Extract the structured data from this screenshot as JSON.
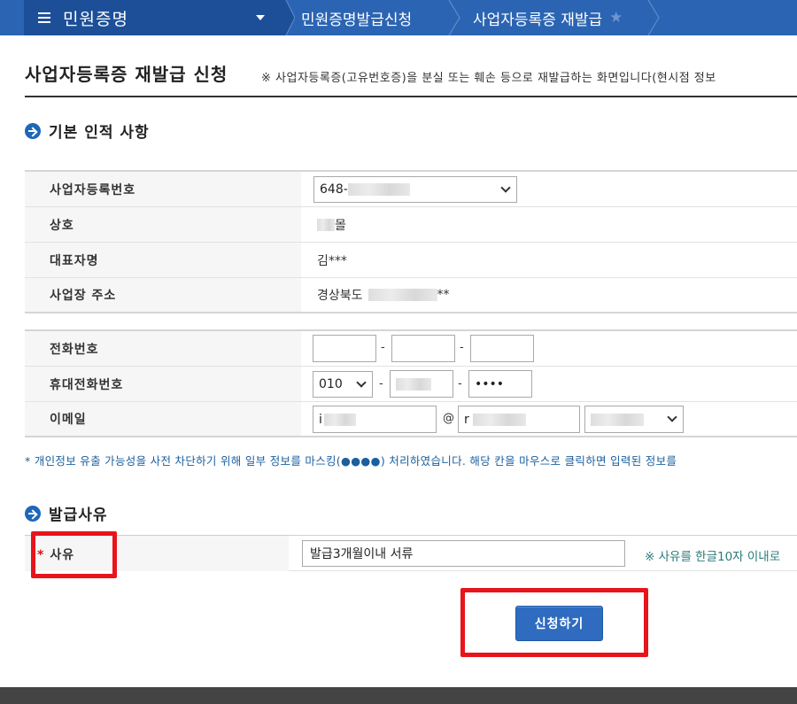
{
  "nav": {
    "menu_label": "민원증명",
    "breadcrumb": [
      "민원증명발급신청",
      "사업자등록증 재발급"
    ]
  },
  "header": {
    "title": "사업자등록증 재발급 신청",
    "note": "※ 사업자등록증(고유번호증)을 분실 또는 훼손 등으로 재발급하는 화면입니다(현시점 정보"
  },
  "basic": {
    "section_title": "기본 인적 사항",
    "rows": {
      "biz_no_label": "사업자등록번호",
      "biz_no_value": "648-",
      "company_label": "상호",
      "company_value": "몰",
      "ceo_label": "대표자명",
      "ceo_value": "김***",
      "address_label": "사업장 주소",
      "address_value": "경상북도",
      "address_suffix": "**"
    },
    "contact": {
      "phone_label": "전화번호",
      "mobile_label": "휴대전화번호",
      "mobile_prefix": "010",
      "mobile_last": "••••",
      "email_label": "이메일",
      "email_local": "i",
      "email_at": "@",
      "email_domain": "r",
      "dash": "-"
    }
  },
  "notice": "* 개인정보 유출 가능성을 사전 차단하기 위해 일부 정보를 마스킹(●●●●) 처리하였습니다. 해당 칸을 마우스로 클릭하면 입력된 정보를",
  "reason": {
    "section_title": "발급사유",
    "required_mark": "*",
    "label": "사유",
    "value": "발급3개월이내 서류",
    "hint": "※ 사유를 한글10자 이내로"
  },
  "actions": {
    "apply_label": "신청하기"
  },
  "colors": {
    "nav_bg": "#2b64b2",
    "menu_bg": "#1c4f98",
    "highlight": "#e8141b",
    "button": "#2f6cc0"
  }
}
